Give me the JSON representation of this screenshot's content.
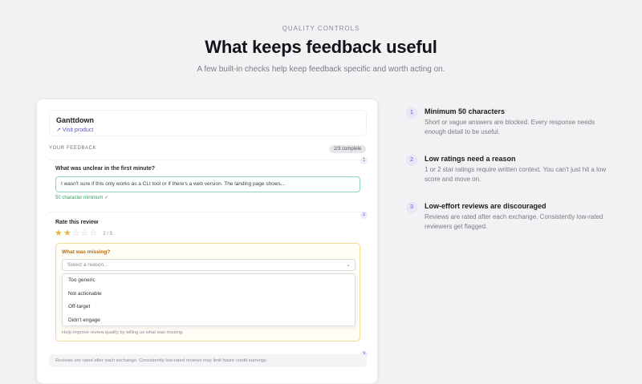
{
  "hero": {
    "eyebrow": "QUALITY CONTROLS",
    "title": "What keeps feedback useful",
    "subtitle": "A few built-in checks help keep feedback specific and worth acting on."
  },
  "card": {
    "product": {
      "name": "Ganttdown",
      "link_label": "Visit product",
      "link_icon": "arrow-up-right-icon"
    },
    "section_label": "YOUR FEEDBACK",
    "progress": "2/3 complete",
    "step_numbers": [
      "1",
      "2",
      "3"
    ],
    "question": {
      "title": "What was unclear in the first minute?",
      "answer_value": "I wasn't sure if this only works as a CLI tool or if there's a web version. The landing page shows...",
      "validation": "50 character minimum ✓"
    },
    "rating": {
      "title": "Rate this review",
      "stars_total": 5,
      "stars_selected": 2,
      "count_label": "2 / 5",
      "star_on_color": "#e7b43c",
      "star_off_color": "#c9c9cf"
    },
    "reason": {
      "title": "What was missing?",
      "placeholder": "Select a reason...",
      "options": [
        "Too generic",
        "Not actionable",
        "Off-target",
        "Didn't engage"
      ],
      "help": "Help improve review quality by telling us what was missing."
    },
    "footer_note": "Reviews are rated after each exchange. Consistently low-rated reviews may limit future credit earnings."
  },
  "features": [
    {
      "number": "1",
      "title": "Minimum 50 characters",
      "description": "Short or vague answers are blocked. Every response needs enough detail to be useful."
    },
    {
      "number": "2",
      "title": "Low ratings need a reason",
      "description": "1 or 2 star ratings require written context. You can't just hit a low score and move on."
    },
    {
      "number": "3",
      "title": "Low-effort reviews are discouraged",
      "description": "Reviews are rated after each exchange. Consistently low-rated reviewers get flagged."
    }
  ],
  "colors": {
    "accent": "#5a56d6",
    "success": "#2c9c64",
    "warning": "#b36b18",
    "background": "#f2f2f4"
  }
}
